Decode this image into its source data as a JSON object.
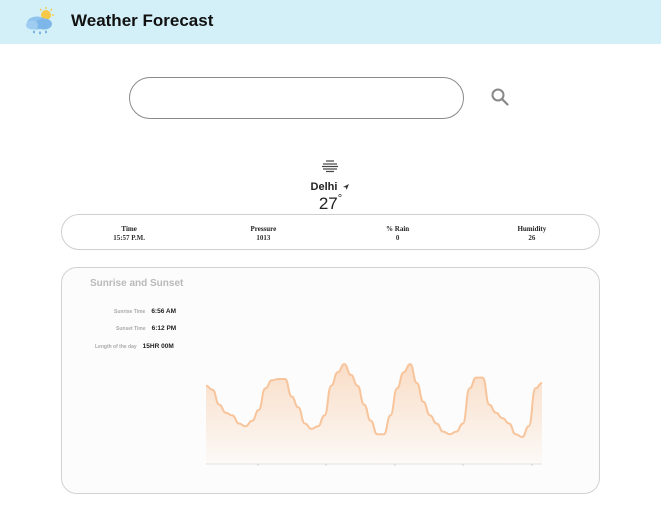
{
  "header": {
    "title": "Weather Forecast",
    "logo_icon": "cloud-rain-sun-icon"
  },
  "search": {
    "value": "",
    "placeholder": "",
    "icon": "search-icon"
  },
  "current": {
    "condition_icon": "fog-icon",
    "city": "Delhi",
    "temperature": "27",
    "unit_symbol": "°"
  },
  "stats": [
    {
      "label": "Time",
      "value": "15:57 P.M."
    },
    {
      "label": "Pressure",
      "value": "1013"
    },
    {
      "label": "% Rain",
      "value": "0"
    },
    {
      "label": "Humidity",
      "value": "26"
    }
  ],
  "sun": {
    "title": "Sunrise and Sunset",
    "rows": [
      {
        "label": "Sunrise Time",
        "value": "6:56 AM"
      },
      {
        "label": "Sunset Time",
        "value": "6:12 PM"
      },
      {
        "label": "Length of the day",
        "value": "15HR 00M"
      }
    ]
  },
  "chart_data": {
    "type": "area",
    "color": "#f7c49b",
    "values": [
      58,
      55,
      44,
      38,
      36,
      30,
      28,
      32,
      40,
      56,
      62,
      63,
      63,
      50,
      42,
      30,
      26,
      28,
      36,
      58,
      68,
      74,
      66,
      58,
      44,
      32,
      22,
      22,
      36,
      56,
      68,
      74,
      60,
      46,
      36,
      30,
      24,
      22,
      24,
      30,
      56,
      64,
      64,
      44,
      38,
      34,
      30,
      22,
      20,
      28,
      56,
      60
    ]
  }
}
